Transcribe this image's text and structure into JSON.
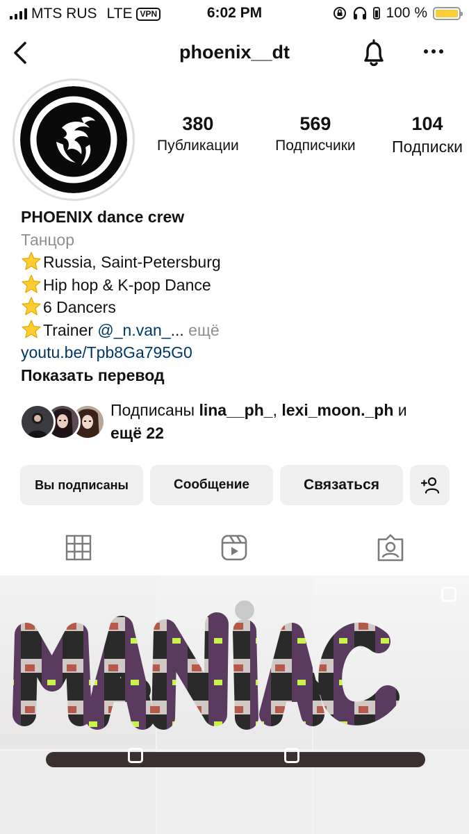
{
  "status_bar": {
    "carrier": "MTS RUS",
    "network": "LTE",
    "vpn": "VPN",
    "time": "6:02 PM",
    "battery_percent": "100 %",
    "battery_level": 1.0,
    "battery_color": "#f7cd3a"
  },
  "header": {
    "username": "phoenix__dt",
    "icons": [
      "back-arrow-icon",
      "bell-icon",
      "more-icon"
    ]
  },
  "profile": {
    "stats": [
      {
        "value": "380",
        "label": "Публикации"
      },
      {
        "value": "569",
        "label": "Подписчики"
      },
      {
        "value": "104",
        "label": "Подписки"
      }
    ],
    "name": "PHOENIX dance crew",
    "category": "Танцор",
    "bio_lines": [
      "Russia, Saint-Petersburg",
      "Hip hop & K-pop Dance",
      "6 Dancers"
    ],
    "trainer_prefix": "Trainer ",
    "trainer_mention": "@_n.van_",
    "ellipsis": "...",
    "more_label": " ещё",
    "link": "youtu.be/Tpb8Ga795G0",
    "translate_label": "Показать перевод"
  },
  "followed_by": {
    "prefix": "Подписаны ",
    "user1": "lina__ph_",
    "separator": ", ",
    "user2": "lexi_moon._ph",
    "conjunction": " и",
    "rest": "ещё 22"
  },
  "actions": {
    "following_label": "Вы подписаны",
    "message_label": "Сообщение",
    "contact_label": "Связаться",
    "add_person_icon": "add-person-icon"
  },
  "tabs": [
    "grid-icon",
    "reels-icon",
    "tagged-icon"
  ],
  "grid": {
    "banner_text": "MANIAC"
  },
  "colors": {
    "link": "#00376b",
    "muted": "#8e8e8e",
    "button_bg": "#efefef"
  }
}
